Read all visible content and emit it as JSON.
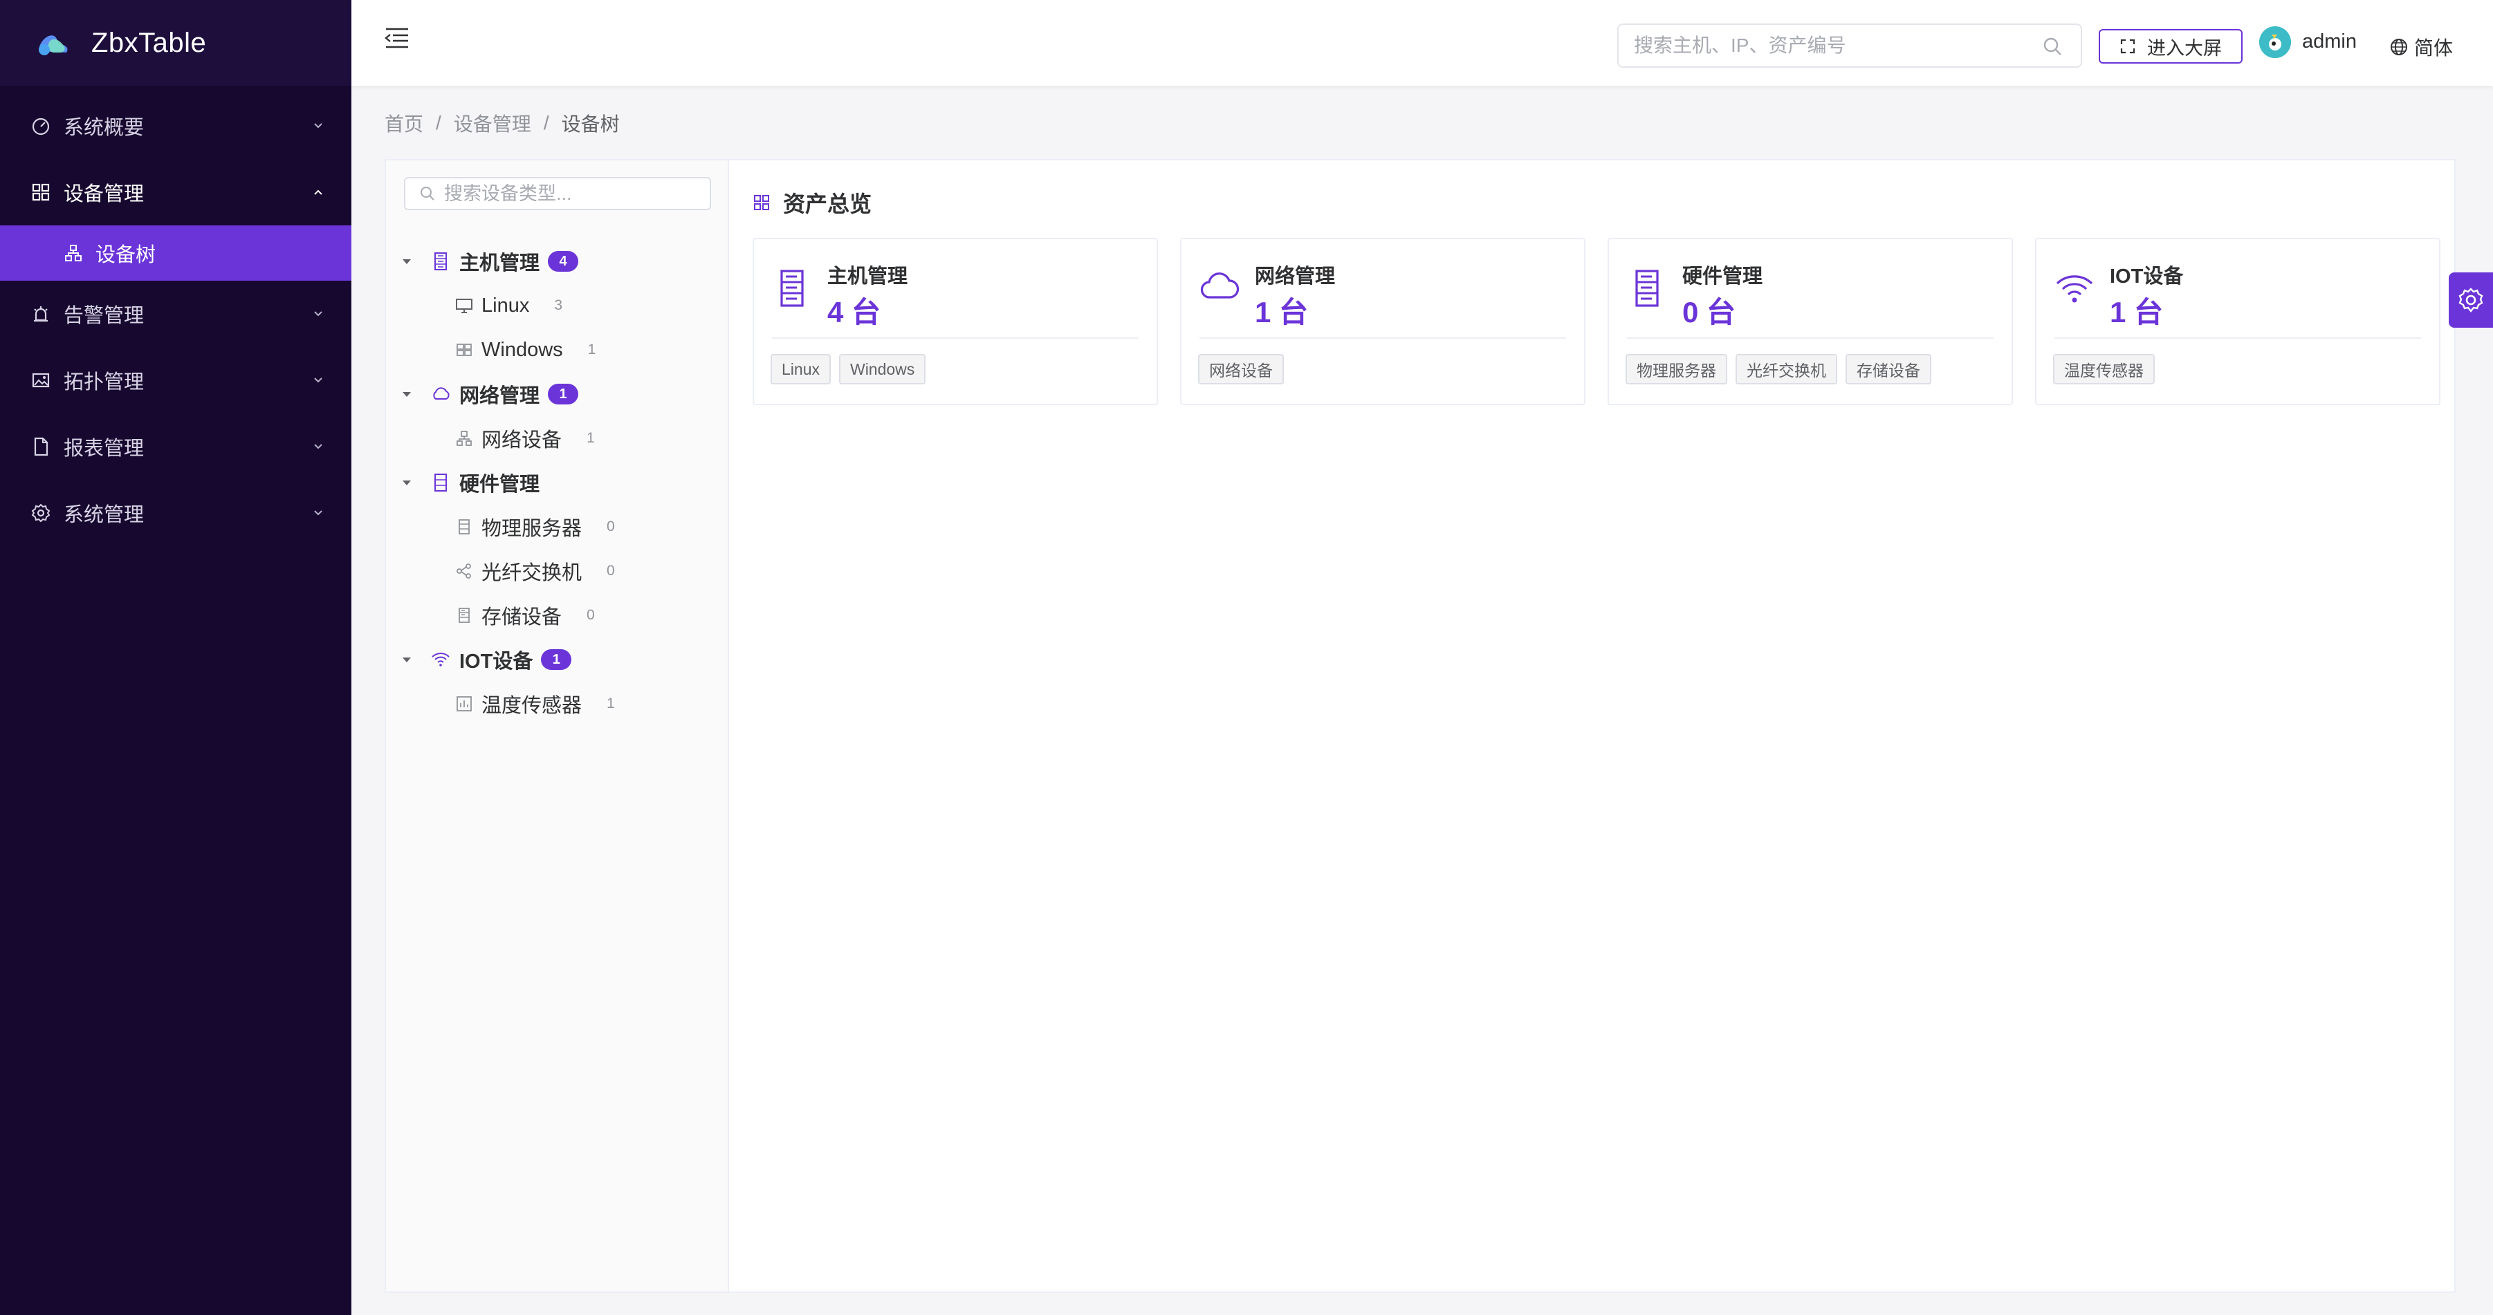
{
  "app": {
    "title": "ZbxTable"
  },
  "colors": {
    "sidebar_bg": "#16082e",
    "accent": "#6b34d8"
  },
  "sidebar": {
    "items": [
      {
        "label": "系统概要",
        "icon": "dashboard-icon",
        "open": false
      },
      {
        "label": "设备管理",
        "icon": "grid-icon",
        "open": true,
        "children": [
          {
            "label": "设备树",
            "icon": "tree-icon",
            "active": true
          }
        ]
      },
      {
        "label": "告警管理",
        "icon": "alarm-icon",
        "open": false
      },
      {
        "label": "拓扑管理",
        "icon": "image-icon",
        "open": false
      },
      {
        "label": "报表管理",
        "icon": "document-icon",
        "open": false
      },
      {
        "label": "系统管理",
        "icon": "gear-icon",
        "open": false
      }
    ]
  },
  "header": {
    "search_placeholder": "搜索主机、IP、资产编号",
    "bigscreen_label": "进入大屏",
    "user_name": "admin",
    "language": "简体"
  },
  "breadcrumb": {
    "items": [
      "首页",
      "设备管理",
      "设备树"
    ]
  },
  "tree": {
    "search_placeholder": "搜索设备类型...",
    "groups": [
      {
        "label": "主机管理",
        "badge": "4",
        "icon": "server-icon",
        "children": [
          {
            "label": "Linux",
            "count": "3",
            "icon": "monitor-icon"
          },
          {
            "label": "Windows",
            "count": "1",
            "icon": "windows-icon"
          }
        ]
      },
      {
        "label": "网络管理",
        "badge": "1",
        "icon": "cloud-icon",
        "children": [
          {
            "label": "网络设备",
            "count": "1",
            "icon": "network-icon"
          }
        ]
      },
      {
        "label": "硬件管理",
        "badge": "",
        "icon": "server-icon",
        "children": [
          {
            "label": "物理服务器",
            "count": "0",
            "icon": "server-icon"
          },
          {
            "label": "光纤交换机",
            "count": "0",
            "icon": "share-icon"
          },
          {
            "label": "存储设备",
            "count": "0",
            "icon": "storage-icon"
          }
        ]
      },
      {
        "label": "IOT设备",
        "badge": "1",
        "icon": "wifi-icon",
        "children": [
          {
            "label": "温度传感器",
            "count": "1",
            "icon": "chart-box-icon"
          }
        ]
      }
    ]
  },
  "overview": {
    "title": "资产总览",
    "cards": [
      {
        "name": "主机管理",
        "count": "4 台",
        "icon": "server-icon",
        "tags": [
          "Linux",
          "Windows"
        ]
      },
      {
        "name": "网络管理",
        "count": "1 台",
        "icon": "cloud-icon",
        "tags": [
          "网络设备"
        ]
      },
      {
        "name": "硬件管理",
        "count": "0 台",
        "icon": "server-icon",
        "tags": [
          "物理服务器",
          "光纤交换机",
          "存储设备"
        ]
      },
      {
        "name": "IOT设备",
        "count": "1 台",
        "icon": "wifi-icon",
        "tags": [
          "温度传感器"
        ]
      }
    ]
  }
}
